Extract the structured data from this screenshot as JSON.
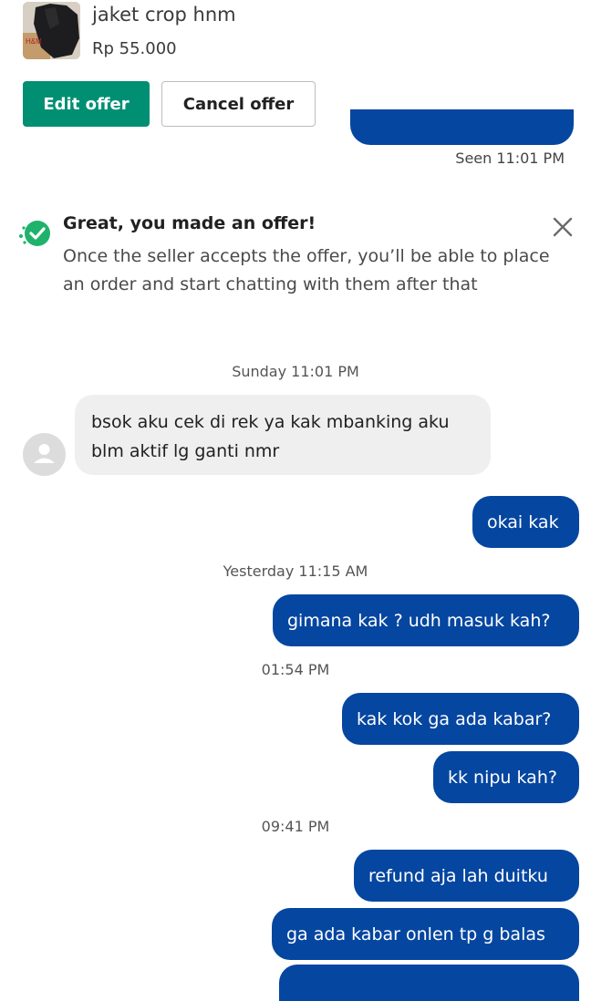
{
  "product": {
    "name": "jaket crop hnm",
    "price": "Rp 55.000",
    "thumbnail_icon": "jacket-photo"
  },
  "actions": {
    "edit_label": "Edit offer",
    "cancel_label": "Cancel offer"
  },
  "previous_message": {
    "status": "Seen 11:01 PM"
  },
  "notice": {
    "title": "Great, you made an offer!",
    "body": "Once the seller accepts the offer, you’ll be able to place an order and start chatting with them after that",
    "icon": "check-badge-icon",
    "close_icon": "close-icon"
  },
  "chat": {
    "timestamps": {
      "t1": "Sunday 11:01 PM",
      "t2": "Yesterday 11:15 AM",
      "t3": "01:54 PM",
      "t4": "09:41 PM"
    },
    "incoming": [
      {
        "text": "bsok aku cek di rek ya kak mbanking aku blm aktif lg ganti nmr"
      }
    ],
    "outgoing": [
      {
        "text": "okai kak"
      },
      {
        "text": "gimana kak ? udh masuk kah?"
      },
      {
        "text": "kak kok ga ada kabar?"
      },
      {
        "text": "kk nipu kah?"
      },
      {
        "text": "refund aja lah duitku"
      },
      {
        "text": "ga ada kabar onlen tp g balas"
      }
    ]
  },
  "colors": {
    "primary_green": "#008f73",
    "outgoing_bubble": "#0546a0",
    "incoming_bubble": "#efefef",
    "check_green": "#1fb26b"
  }
}
